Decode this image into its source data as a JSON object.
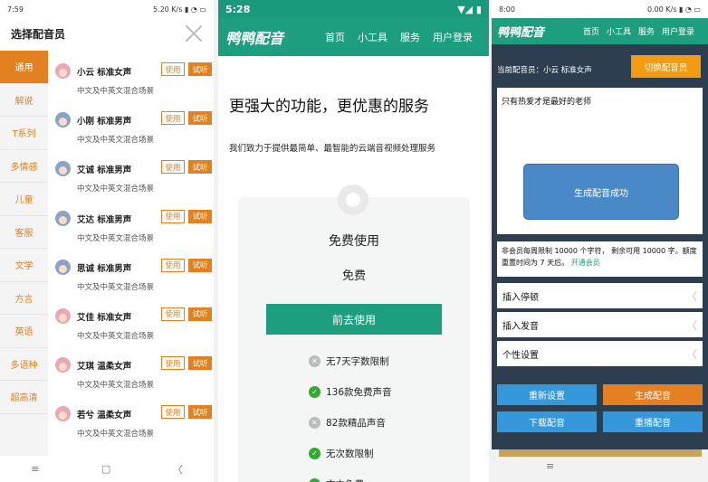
{
  "panel1": {
    "status": {
      "time": "7:59",
      "icons": "5.20 K/s ▮ ◔ ▭"
    },
    "title": "选择配音员",
    "categories": [
      "通用",
      "解说",
      "T系列",
      "多情感",
      "儿童",
      "客服",
      "文学",
      "方言",
      "英语",
      "多语种",
      "超高清"
    ],
    "voices": [
      {
        "name": "小云 标准女声",
        "desc": "中文及中英文混合场景",
        "gender": "f"
      },
      {
        "name": "小刚 标准男声",
        "desc": "中文及中英文混合场景",
        "gender": "m"
      },
      {
        "name": "艾诚 标准男声",
        "desc": "中文及中英文混合场景",
        "gender": "m"
      },
      {
        "name": "艾达 标准男声",
        "desc": "中文及中英文混合场景",
        "gender": "m"
      },
      {
        "name": "思诚 标准男声",
        "desc": "中文及中英文混合场景",
        "gender": "m"
      },
      {
        "name": "艾佳 标准女声",
        "desc": "中文及中英文混合场景",
        "gender": "f"
      },
      {
        "name": "艾琪 温柔女声",
        "desc": "中文及中英文混合场景",
        "gender": "f"
      },
      {
        "name": "若兮 温柔女声",
        "desc": "中文及中英文混合场景",
        "gender": "f"
      }
    ],
    "use_label": "使用",
    "try_label": "试听",
    "nav": {
      "menu": "≡",
      "home": "▢",
      "back": "〈"
    }
  },
  "panel2": {
    "status": {
      "time": "5:28",
      "icons": "▼◢ ▮"
    },
    "logo": "鸭鸭配音",
    "nav_links": [
      "首页",
      "小工具",
      "服务",
      "用户登录"
    ],
    "headline": "更强大的功能，更优惠的服务",
    "subline": "我们致力于提供最简单、最智能的云端音视频处理服务",
    "plan_title": "免费使用",
    "plan_price": "免费",
    "cta": "前去使用",
    "features": [
      {
        "text": "无7天字数限制",
        "ok": false
      },
      {
        "text": "136款免费声音",
        "ok": true
      },
      {
        "text": "82款精品声音",
        "ok": false
      },
      {
        "text": "无次数限制",
        "ok": true
      },
      {
        "text": "文本免费",
        "ok": true
      }
    ]
  },
  "panel3": {
    "status": {
      "time": "8:00",
      "icons": "0.00 K/s ▮ ◔ ▭"
    },
    "logo": "鸭鸭配音",
    "nav_links": [
      "首页",
      "小工具",
      "服务",
      "用户登录"
    ],
    "current_voice": "当前配音员：小云 标准女声",
    "switch_btn": "切换配音员",
    "input_text": "只有热爱才是最好的老师",
    "success_msg": "生成配音成功",
    "quota_text": "非会员每周限制 10000 个字符， 剩余可用 10000 字。额度重置时间为 7 天后。",
    "quota_link": "开通会员",
    "options": [
      "插入停顿",
      "插入发音",
      "个性设置"
    ],
    "buttons": {
      "reset": "重新设置",
      "generate": "生成配音",
      "download": "下载配音",
      "replay": "重播配音"
    },
    "nav_menu": "≡"
  },
  "colors": {
    "teal": "#1d9e7e",
    "orange": "#e3801f",
    "blue": "#3498db",
    "dark": "#2c3e50"
  }
}
